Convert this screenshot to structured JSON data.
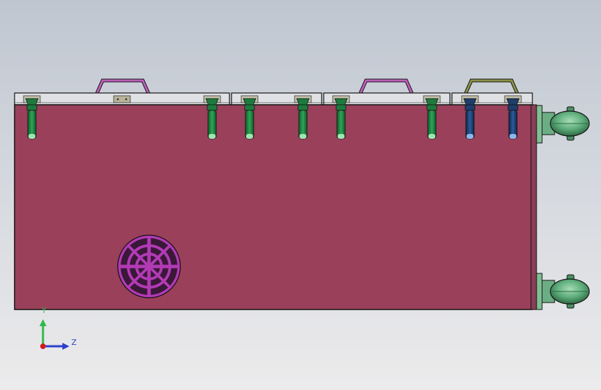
{
  "viewport": {
    "background_top": "#bfc6d0",
    "background_bottom": "#ecebec"
  },
  "model": {
    "body_color": "#9a405a",
    "lid_color": "#dfe1e4",
    "edge_color": "#111111",
    "handles": [
      {
        "color": "#c060bc"
      },
      {
        "color": "#c060bc"
      },
      {
        "color": "#8d9346"
      }
    ],
    "latches": [
      {
        "color": "#1e7a3e"
      },
      {
        "color": "#1e7a3e"
      },
      {
        "color": "#1e7a3e"
      },
      {
        "color": "#1e7a3e"
      },
      {
        "color": "#1e7a3e"
      },
      {
        "color": "#1e7a3e"
      },
      {
        "color": "#1e3d6a"
      },
      {
        "color": "#1e3d6a"
      }
    ],
    "fan_grille_color": "#b23ab5",
    "caster_color": "#5fae7c",
    "caster_count": 2
  },
  "triad": {
    "y_label": "Y",
    "z_label": "Z",
    "y_color": "#2fb84a",
    "z_color": "#2a3fd0",
    "origin_color": "#d21c1c"
  }
}
